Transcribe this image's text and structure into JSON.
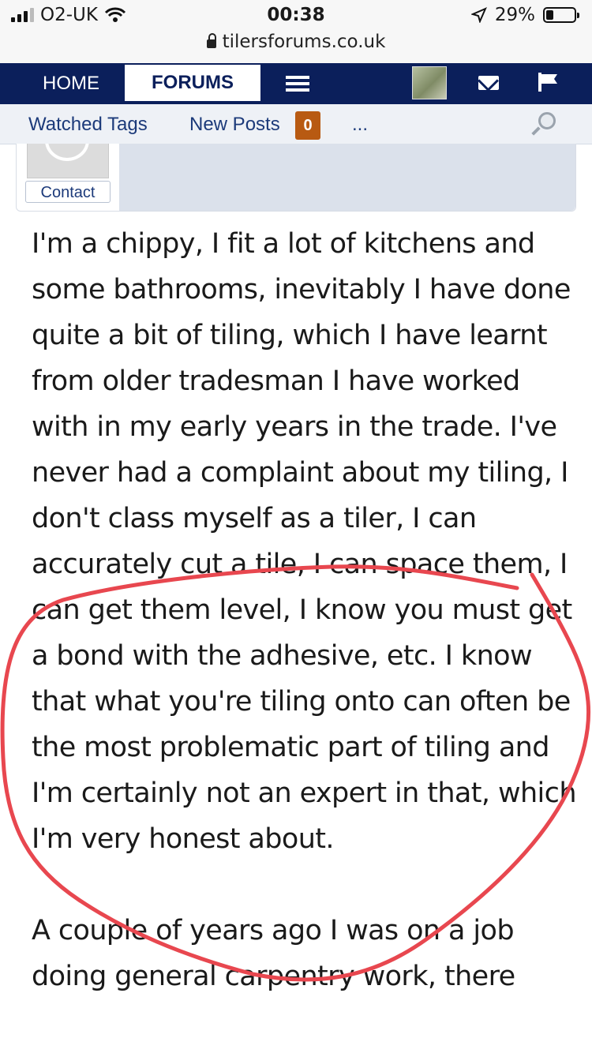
{
  "status_bar": {
    "carrier": "O2-UK",
    "time": "00:38",
    "battery": "29%",
    "battery_level": 0.29,
    "url": "tilersforums.co.uk"
  },
  "nav": {
    "home": "HOME",
    "forums": "FORUMS"
  },
  "subnav": {
    "watched_tags": "Watched Tags",
    "new_posts": "New Posts",
    "new_posts_count": "0",
    "more": "..."
  },
  "post": {
    "contact_label": "Contact",
    "paragraphs": [
      "I'm a chippy, I fit a lot of kitchens and some bathrooms, inevitably I have done quite a bit of tiling, which I have learnt from older tradesman I have worked with in my early years in the trade. I've never had a complaint about my tiling, I don't class myself as a tiler, I can accurately cut a tile, I can space them, I can get them level, I know you must get a bond with the adhesive, etc. I know that what you're tiling onto can often be the most problematic part of tiling and I'm certainly not an expert in that, which I'm very honest about.",
      "A couple of years ago I was on a job doing general carpentry work, there"
    ]
  },
  "colors": {
    "nav_bg": "#0b1f5b",
    "link": "#1c3a7a",
    "badge": "#b85a12",
    "annotation": "#e8474f"
  }
}
